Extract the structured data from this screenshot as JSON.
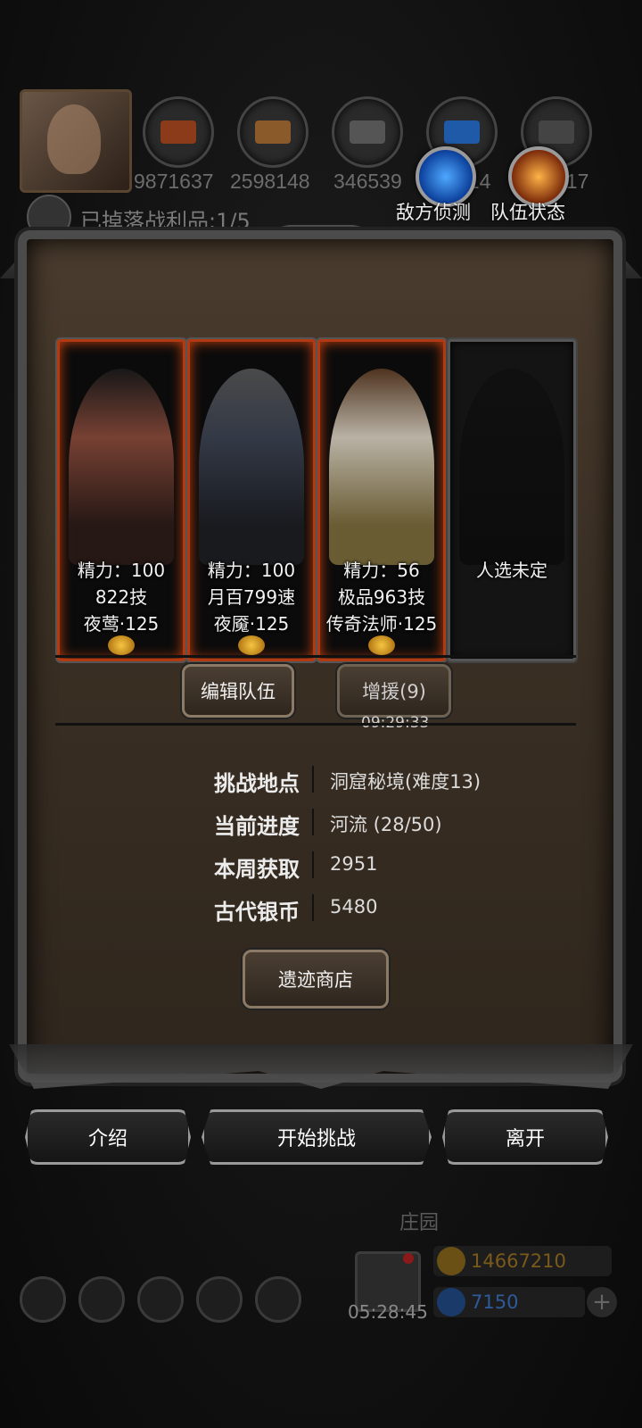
{
  "hud": {
    "resources": [
      {
        "value": "9871637",
        "icon": "ore-icon",
        "color": "#8b3b1a"
      },
      {
        "value": "2598148",
        "icon": "wood-icon",
        "color": "#8a5a2a"
      },
      {
        "value": "346539",
        "icon": "ingot-icon",
        "color": "#555555"
      },
      {
        "value": "514",
        "icon": "crystal-icon",
        "color": "#1e5aa8"
      },
      {
        "value": "917",
        "icon": "iron-icon",
        "color": "#444444"
      }
    ],
    "loot_text": "已掉落战利品:1/5",
    "enemy_scout_label": "敌方侦测",
    "team_status_label": "队伍状态"
  },
  "heroes": [
    {
      "energy": "精力：100",
      "skill": "822技",
      "name": "夜莺·125",
      "colors": "#8a4a3a"
    },
    {
      "energy": "精力：100",
      "skill": "月百799速",
      "name": "夜魇·125",
      "colors": "#3a4150"
    },
    {
      "energy": "精力：56",
      "skill": "极品963技",
      "name": "传奇法师·125",
      "colors": "#7a6a3a"
    },
    {
      "empty_label": "人选未定"
    }
  ],
  "actions": {
    "edit_team": "编辑队伍",
    "reinforce": "增援(9)",
    "reinforce_timer": "09:29:33"
  },
  "info": [
    {
      "label": "挑战地点",
      "value": "洞窟秘境(难度13)"
    },
    {
      "label": "当前进度",
      "value": "河流 (28/50)"
    },
    {
      "label": "本周获取",
      "value": "2951"
    },
    {
      "label": "古代银币",
      "value": "5480"
    }
  ],
  "shop_button": "遗迹商店",
  "bottom_buttons": {
    "intro": "介绍",
    "start": "开始挑战",
    "leave": "离开"
  },
  "background_hud": {
    "manor_label": "庄园",
    "gift_timer": "05:28:45",
    "gold": "14667210",
    "gems": "7150"
  },
  "colors": {
    "accent_orange": "#b13a12",
    "frame": "#4b4b4b",
    "panel": "#3b3024",
    "gold_text": "#8a6a2a",
    "gem_text": "#3a6ab0"
  }
}
